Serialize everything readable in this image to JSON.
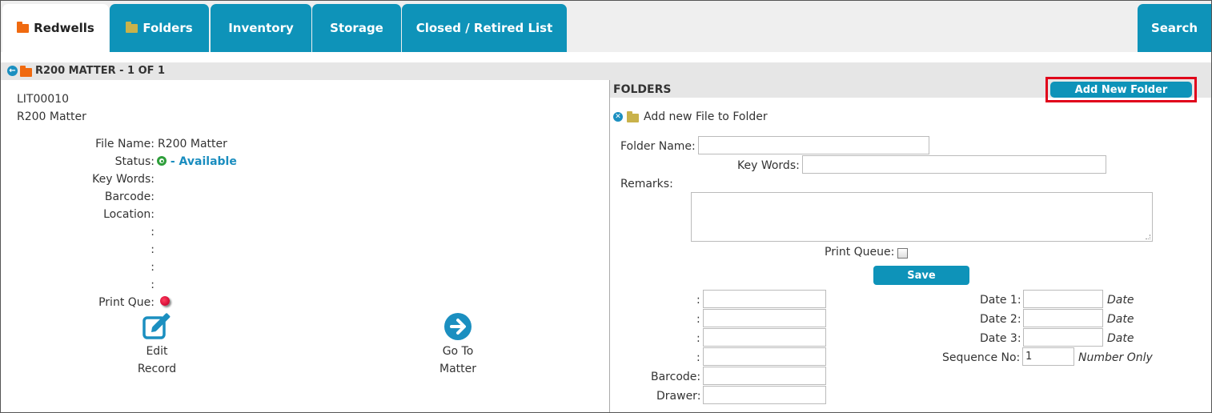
{
  "tabs": [
    {
      "label": "Redwells",
      "icon": "folder-icon"
    },
    {
      "label": "Folders",
      "icon": "folder-icon"
    },
    {
      "label": "Inventory"
    },
    {
      "label": "Storage"
    },
    {
      "label": "Closed / Retired List"
    }
  ],
  "search_tab": "Search",
  "left": {
    "header": "R200 MATTER - 1 OF 1",
    "record_id": "LIT00010",
    "record_name": "R200 Matter",
    "fields": {
      "file_name_label": "File Name:",
      "file_name_value": "R200 Matter",
      "status_label": "Status:",
      "status_value": " - Available",
      "key_words_label": "Key Words:",
      "barcode_label": "Barcode:",
      "location_label": "Location:",
      "colon1": ":",
      "colon2": ":",
      "colon3": ":",
      "colon4": ":",
      "print_que_label": "Print Que:"
    },
    "actions": {
      "edit_line1": "Edit",
      "edit_line2": "Record",
      "goto_line1": "Go To",
      "goto_line2": "Matter"
    }
  },
  "right": {
    "title": "FOLDERS",
    "add_new_folder": "Add New Folder",
    "add_file_text": "Add new File to Folder",
    "folder_name_label": "Folder Name:",
    "key_words_label": "Key Words:",
    "remarks_label": "Remarks:",
    "print_queue_label": "Print Queue:",
    "save_label": "Save",
    "colon": ":",
    "barcode_label": "Barcode:",
    "drawer_label": "Drawer:",
    "date1_label": "Date 1:",
    "date2_label": "Date 2:",
    "date3_label": "Date 3:",
    "date_hint": "Date",
    "sequence_label": "Sequence No:",
    "sequence_value": "1",
    "number_only": "Number Only"
  }
}
